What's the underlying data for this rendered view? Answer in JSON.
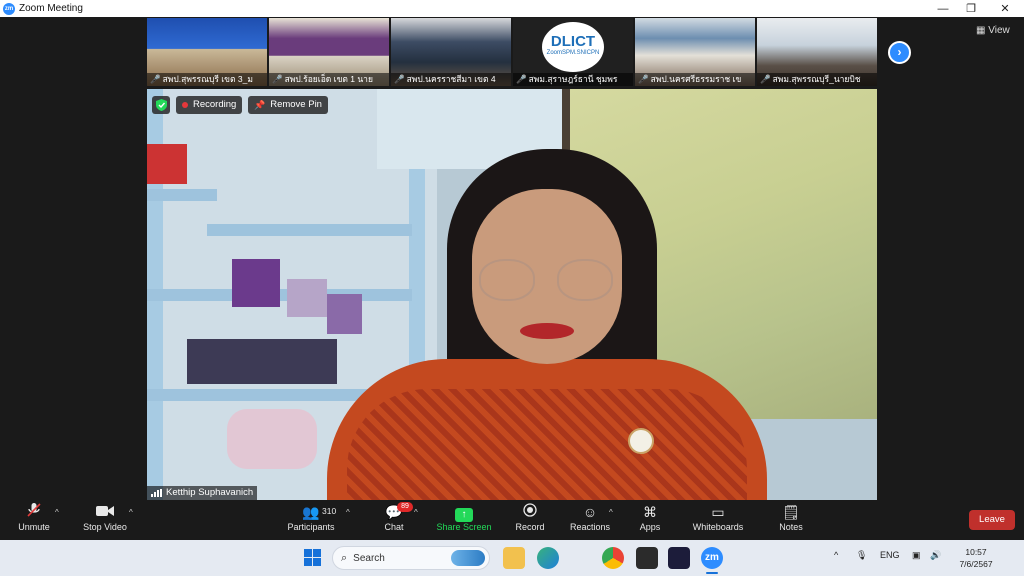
{
  "window": {
    "app_icon": "zm",
    "title": "Zoom Meeting",
    "controls": [
      {
        "name": "minimize-button",
        "glyph": "—"
      },
      {
        "name": "restore-button",
        "glyph": "❐"
      },
      {
        "name": "close-button",
        "glyph": "✕"
      }
    ]
  },
  "gallery": {
    "thumbnails": [
      {
        "label": "สพป.สุพรรณบุรี เขต 3_ม"
      },
      {
        "label": "สพป.ร้อยเอ็ด เขต 1 นาย"
      },
      {
        "label": "สพป.นครราชสีมา เขต 4"
      },
      {
        "label": "สพม.สุราษฎร์ธานี ชุมพร",
        "logo_text": "DLICT",
        "logo_sub": "ZoomSPM.SNICPN"
      },
      {
        "label": "สพป.นครศรีธรรมราช เข"
      },
      {
        "label": "สพม.สุพรรณบุรี_นายบิช"
      }
    ],
    "next_glyph": "›",
    "view_label": "View"
  },
  "main_video": {
    "recording_label": "Recording",
    "remove_pin_label": "Remove Pin",
    "participant_name": "Ketthip Suphavanich"
  },
  "toolbar": {
    "unmute_label": "Unmute",
    "stop_video_label": "Stop Video",
    "participants_label": "Participants",
    "participants_count": "310",
    "chat_label": "Chat",
    "chat_badge": "89",
    "share_label": "Share Screen",
    "record_label": "Record",
    "reactions_label": "Reactions",
    "apps_label": "Apps",
    "whiteboards_label": "Whiteboards",
    "notes_label": "Notes",
    "leave_label": "Leave",
    "accent": "#23d959"
  },
  "taskbar": {
    "search_placeholder": "Search",
    "apps": [
      "file-explorer",
      "edge",
      "chrome",
      "terminal",
      "teams",
      "zoom"
    ],
    "zoom_label": "zm",
    "language": "ENG",
    "time": "10:57",
    "date": "7/6/2567"
  }
}
